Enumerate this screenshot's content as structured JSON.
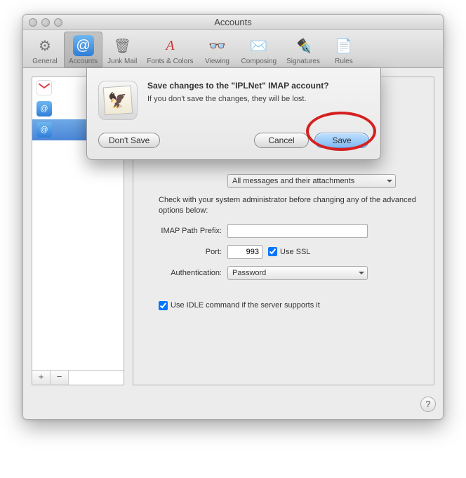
{
  "window": {
    "title": "Accounts"
  },
  "toolbar": {
    "items": [
      {
        "label": "General"
      },
      {
        "label": "Accounts"
      },
      {
        "label": "Junk Mail"
      },
      {
        "label": "Fonts & Colors"
      },
      {
        "label": "Viewing"
      },
      {
        "label": "Composing"
      },
      {
        "label": "Signatures"
      },
      {
        "label": "Rules"
      }
    ]
  },
  "sidebar": {
    "accounts": [
      {
        "label": ""
      },
      {
        "label": ""
      },
      {
        "label": ""
      }
    ],
    "footer": {
      "plus": "+",
      "minus": "−"
    }
  },
  "pane": {
    "trunc_select": "All messages and their attachments",
    "note": "Check with your system administrator before changing any of the advanced options below:",
    "prefix_label": "IMAP Path Prefix:",
    "prefix_value": "",
    "port_label": "Port:",
    "port_value": "993",
    "use_ssl": "Use SSL",
    "auth_label": "Authentication:",
    "auth_value": "Password",
    "idle": "Use IDLE command if the server supports it"
  },
  "sheet": {
    "title": "Save changes to the \"IPLNet\" IMAP account?",
    "subtitle": "If you don't save the changes, they will be lost.",
    "dont_save": "Don't Save",
    "cancel": "Cancel",
    "save": "Save"
  },
  "help": "?"
}
